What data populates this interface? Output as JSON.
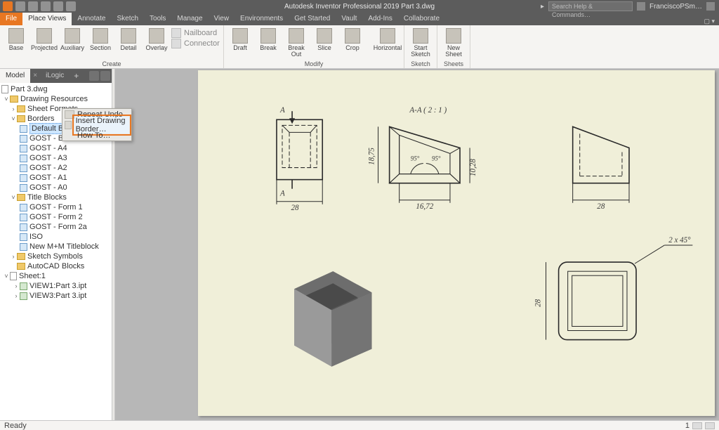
{
  "app": {
    "title": "Autodesk Inventor Professional 2019   Part 3.dwg",
    "search_placeholder": "Search Help & Commands…",
    "user": "FranciscoPSm…"
  },
  "tabs": {
    "file": "File",
    "list": [
      "Place Views",
      "Annotate",
      "Sketch",
      "Tools",
      "Manage",
      "View",
      "Environments",
      "Get Started",
      "Vault",
      "Add-Ins",
      "Collaborate"
    ],
    "active_index": 0
  },
  "ribbon": {
    "groups": [
      {
        "label": "Create",
        "buttons": [
          "Base",
          "Projected",
          "Auxiliary",
          "Section",
          "Detail",
          "Overlay"
        ],
        "side": [
          "Nailboard",
          "Connector"
        ]
      },
      {
        "label": "Modify",
        "buttons": [
          "Draft",
          "Break",
          "Break Out",
          "Slice",
          "Crop",
          "",
          "Horizontal"
        ]
      },
      {
        "label": "Sketch",
        "buttons": [
          "Start Sketch"
        ]
      },
      {
        "label": "Sheets",
        "buttons": [
          "New Sheet"
        ]
      }
    ]
  },
  "browser": {
    "tabs": {
      "model": "Model",
      "ilogic": "iLogic"
    },
    "root": "Part 3.dwg",
    "drawing_resources": "Drawing Resources",
    "sheet_formats": "Sheet Formats",
    "borders": "Borders",
    "border_items": [
      "Default Border",
      "GOST - Border",
      "GOST - A4",
      "GOST - A3",
      "GOST - A2",
      "GOST - A1",
      "GOST - A0"
    ],
    "title_blocks": "Title Blocks",
    "title_block_items": [
      "GOST - Form 1",
      "GOST - Form 2",
      "GOST - Form 2a",
      "ISO",
      "New M+M Titleblock"
    ],
    "sketch_symbols": "Sketch Symbols",
    "autocad_blocks": "AutoCAD Blocks",
    "sheet1": "Sheet:1",
    "views": [
      "VIEW1:Part 3.ipt",
      "VIEW3:Part 3.ipt"
    ]
  },
  "context_menu": {
    "repeat": "Repeat Undo",
    "insert": "Insert Drawing Border…",
    "howto": "How To…"
  },
  "drawing": {
    "section_label_top": "A",
    "section_label_bottom": "A",
    "width_dim": "28",
    "section_title": "A-A ( 2 : 1 )",
    "h_dim": "18,75",
    "angle1": "95°",
    "angle2": "95°",
    "inner_w": "16,72",
    "t_dim": "10,28",
    "right_width": "28",
    "side_h": "28",
    "chamfer": "2 x 45°"
  },
  "status": {
    "text": "Ready",
    "page": "1"
  }
}
